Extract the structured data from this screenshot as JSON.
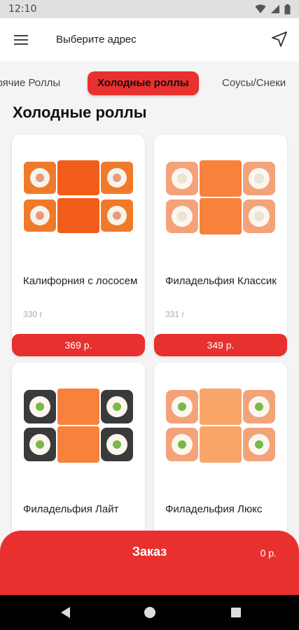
{
  "status": {
    "time": "12:10"
  },
  "appbar": {
    "address": "Выберите адрес"
  },
  "tabs": [
    {
      "label": "Горячие Роллы"
    },
    {
      "label": "Холодные роллы"
    },
    {
      "label": "Соусы/Снеки"
    }
  ],
  "section_title": "Холодные роллы",
  "products": [
    {
      "name": "Калифорния с лососем",
      "weight": "330 г",
      "price": "369 р."
    },
    {
      "name": "Филадельфия Классик",
      "weight": "331 г",
      "price": "349 р."
    },
    {
      "name": "Филадельфия Лайт",
      "weight": "",
      "price": ""
    },
    {
      "name": "Филадельфия Люкс",
      "weight": "",
      "price": ""
    }
  ],
  "order": {
    "label": "Заказ",
    "total": "0 р."
  },
  "colors": {
    "accent": "#e8302e"
  }
}
